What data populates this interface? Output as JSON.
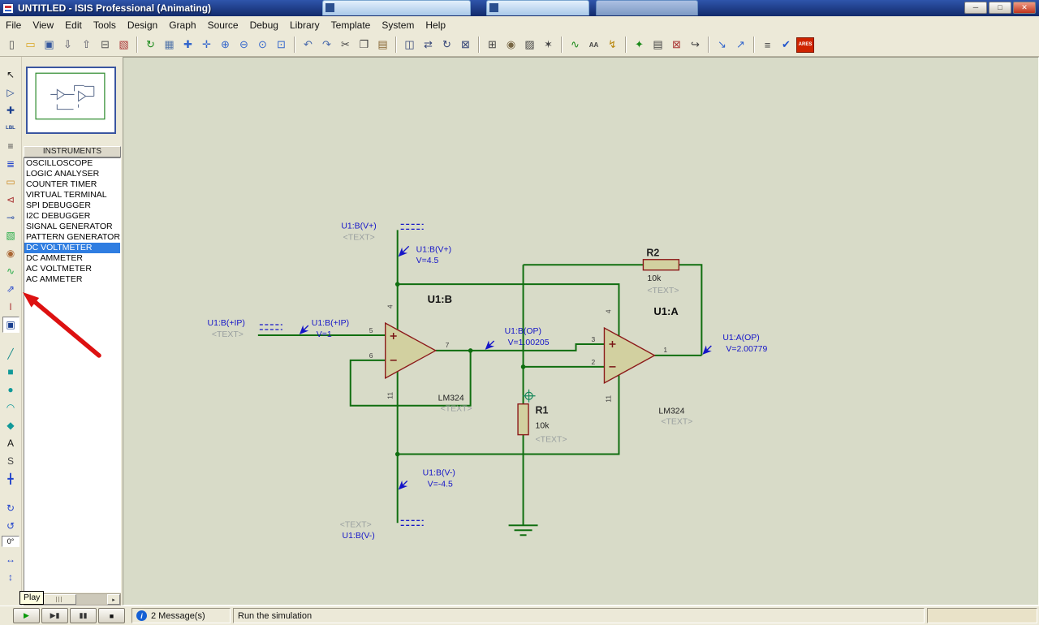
{
  "titlebar": {
    "title": "UNTITLED - ISIS Professional (Animating)",
    "window_buttons": [
      {
        "name": "minimize-button",
        "glyph": "─"
      },
      {
        "name": "maximize-button",
        "glyph": "□"
      },
      {
        "name": "close-button",
        "glyph": "✕"
      }
    ]
  },
  "menu": {
    "items": [
      "File",
      "View",
      "Edit",
      "Tools",
      "Design",
      "Graph",
      "Source",
      "Debug",
      "Library",
      "Template",
      "System",
      "Help"
    ]
  },
  "toolbar": {
    "groups": [
      [
        {
          "name": "new-design-icon",
          "glyph": "▯",
          "color": "#555"
        },
        {
          "name": "open-design-icon",
          "glyph": "▭",
          "color": "#d9a520"
        },
        {
          "name": "save-design-icon",
          "glyph": "▣",
          "color": "#35589e"
        },
        {
          "name": "import-section-icon",
          "glyph": "⇩",
          "color": "#556"
        },
        {
          "name": "export-section-icon",
          "glyph": "⇧",
          "color": "#556"
        },
        {
          "name": "print-design-icon",
          "glyph": "⊟",
          "color": "#555"
        },
        {
          "name": "mark-output-area-icon",
          "glyph": "▧",
          "color": "#a33"
        }
      ],
      [
        {
          "name": "redraw-display-icon",
          "glyph": "↻",
          "color": "#1a8a1a"
        },
        {
          "name": "toggle-grid-icon",
          "glyph": "▦",
          "color": "#5577aa"
        },
        {
          "name": "toggle-origin-icon",
          "glyph": "✚",
          "color": "#3366cc"
        },
        {
          "name": "center-at-cursor-icon",
          "glyph": "✛",
          "color": "#3366cc"
        },
        {
          "name": "zoom-in-icon",
          "glyph": "⊕",
          "color": "#3366cc"
        },
        {
          "name": "zoom-out-icon",
          "glyph": "⊖",
          "color": "#3366cc"
        },
        {
          "name": "zoom-all-icon",
          "glyph": "⊙",
          "color": "#3366cc"
        },
        {
          "name": "zoom-area-icon",
          "glyph": "⊡",
          "color": "#3366cc"
        }
      ],
      [
        {
          "name": "undo-icon",
          "glyph": "↶",
          "color": "#4466aa"
        },
        {
          "name": "redo-icon",
          "glyph": "↷",
          "color": "#4466aa"
        },
        {
          "name": "cut-icon",
          "glyph": "✂",
          "color": "#444"
        },
        {
          "name": "copy-icon",
          "glyph": "❐",
          "color": "#444"
        },
        {
          "name": "paste-icon",
          "glyph": "▤",
          "color": "#886633"
        }
      ],
      [
        {
          "name": "block-copy-icon",
          "glyph": "◫",
          "color": "#334477"
        },
        {
          "name": "block-move-icon",
          "glyph": "⇄",
          "color": "#334477"
        },
        {
          "name": "block-rotate-icon",
          "glyph": "↻",
          "color": "#334477"
        },
        {
          "name": "block-delete-icon",
          "glyph": "⊠",
          "color": "#334477"
        }
      ],
      [
        {
          "name": "pick-parts-icon",
          "glyph": "⊞",
          "color": "#444"
        },
        {
          "name": "make-device-icon",
          "glyph": "◉",
          "color": "#776644"
        },
        {
          "name": "packaging-tool-icon",
          "glyph": "▨",
          "color": "#444"
        },
        {
          "name": "decompose-icon",
          "glyph": "✶",
          "color": "#444"
        }
      ],
      [
        {
          "name": "wire-autorouter-icon",
          "glyph": "∿",
          "color": "#1a8a1a"
        },
        {
          "name": "search-tag-icon",
          "glyph": "AA",
          "color": "#444",
          "small": true
        },
        {
          "name": "property-assignment-icon",
          "glyph": "↯",
          "color": "#b8860b"
        }
      ],
      [
        {
          "name": "design-explorer-icon",
          "glyph": "✦",
          "color": "#1a8a1a"
        },
        {
          "name": "new-sheet-icon",
          "glyph": "▤",
          "color": "#444"
        },
        {
          "name": "remove-sheet-icon",
          "glyph": "⊠",
          "color": "#a33"
        },
        {
          "name": "goto-sheet-icon",
          "glyph": "↪",
          "color": "#444"
        }
      ],
      [
        {
          "name": "zoom-to-child-icon",
          "glyph": "↘",
          "color": "#3366cc"
        },
        {
          "name": "return-to-parent-icon",
          "glyph": "↗",
          "color": "#3366cc"
        }
      ],
      [
        {
          "name": "bill-of-materials-icon",
          "glyph": "≡",
          "color": "#444"
        },
        {
          "name": "electrical-rules-check-icon",
          "glyph": "✔",
          "color": "#2255cc"
        },
        {
          "name": "netlist-to-ares-icon",
          "glyph": "ARES",
          "color": "#fff",
          "special": true
        }
      ]
    ]
  },
  "mode_toolbar": {
    "groups": [
      [
        {
          "name": "selection-pointer-icon",
          "glyph": "↖",
          "color": "#111"
        },
        {
          "name": "component-mode-icon",
          "glyph": "▷",
          "color": "#1a3f8f"
        },
        {
          "name": "junction-dot-icon",
          "glyph": "✚",
          "color": "#1a3f8f"
        },
        {
          "name": "wire-label-icon",
          "glyph": "LBL",
          "color": "#1a3f8f",
          "small": true
        },
        {
          "name": "text-script-icon",
          "glyph": "≡",
          "color": "#444"
        },
        {
          "name": "buses-icon",
          "glyph": "≣",
          "color": "#2244cc"
        },
        {
          "name": "subcircuit-icon",
          "glyph": "▭",
          "color": "#cc8822"
        },
        {
          "name": "terminal-icon",
          "glyph": "⊲",
          "color": "#aa3333"
        },
        {
          "name": "device-pin-icon",
          "glyph": "⊸",
          "color": "#3355aa"
        },
        {
          "name": "graph-icon",
          "glyph": "▧",
          "color": "#22aa44"
        },
        {
          "name": "tape-recorder-icon",
          "glyph": "◉",
          "color": "#aa6633"
        },
        {
          "name": "generator-icon",
          "glyph": "∿",
          "color": "#22aa44"
        },
        {
          "name": "voltage-probe-icon",
          "glyph": "⇗",
          "color": "#2244cc"
        },
        {
          "name": "current-probe-icon",
          "glyph": "I",
          "color": "#aa3333"
        },
        {
          "name": "virtual-instruments-icon",
          "glyph": "▣",
          "color": "#1a3f8f",
          "active": true
        }
      ],
      [
        {
          "name": "line-2d-icon",
          "glyph": "╱",
          "color": "#118888"
        },
        {
          "name": "box-2d-icon",
          "glyph": "■",
          "color": "#119999"
        },
        {
          "name": "circle-2d-icon",
          "glyph": "●",
          "color": "#119999"
        },
        {
          "name": "arc-2d-icon",
          "glyph": "◠",
          "color": "#119999"
        },
        {
          "name": "closed-path-2d-icon",
          "glyph": "◆",
          "color": "#119999"
        },
        {
          "name": "text-2d-icon",
          "glyph": "A",
          "color": "#111"
        },
        {
          "name": "symbol-2d-icon",
          "glyph": "S",
          "color": "#444"
        },
        {
          "name": "marker-2d-icon",
          "glyph": "╋",
          "color": "#2244cc"
        }
      ],
      [
        {
          "name": "rotate-clockwise-icon",
          "glyph": "↻",
          "color": "#2244cc"
        },
        {
          "name": "rotate-anticlockwise-icon",
          "glyph": "↺",
          "color": "#2244cc"
        },
        {
          "name": "rotation-angle-field",
          "glyph": "0°",
          "field": true
        },
        {
          "name": "mirror-horizontal-icon",
          "glyph": "↔",
          "color": "#2244cc"
        },
        {
          "name": "mirror-vertical-icon",
          "glyph": "↕",
          "color": "#2244cc"
        }
      ]
    ]
  },
  "instruments": {
    "header": "INSTRUMENTS",
    "selected_index": 8,
    "items": [
      "OSCILLOSCOPE",
      "LOGIC ANALYSER",
      "COUNTER TIMER",
      "VIRTUAL TERMINAL",
      "SPI DEBUGGER",
      "I2C DEBUGGER",
      "SIGNAL GENERATOR",
      "PATTERN GENERATOR",
      "DC VOLTMETER",
      "DC AMMETER",
      "AC VOLTMETER",
      "AC AMMETER"
    ]
  },
  "circuit": {
    "u1b": {
      "ref": "U1:B",
      "part": "LM324",
      "placeholder": "<TEXT>",
      "pin_plus": "5",
      "pin_minus": "6",
      "pin_out": "7",
      "pin_vcc": "4",
      "pin_vee": "11"
    },
    "u1a": {
      "ref": "U1:A",
      "part": "LM324",
      "placeholder": "<TEXT>",
      "pin_plus": "3",
      "pin_minus": "2",
      "pin_out": "1",
      "pin_vcc": "4",
      "pin_vee": "11"
    },
    "r1": {
      "ref": "R1",
      "value": "10k",
      "placeholder": "<TEXT>"
    },
    "r2": {
      "ref": "R2",
      "value": "10k",
      "placeholder": "<TEXT>"
    },
    "terminals": [
      {
        "label": "U1:B(V+)",
        "placeholder": "<TEXT>"
      },
      {
        "label": "U1:B(+IP)",
        "placeholder": "<TEXT>"
      },
      {
        "label": "U1:B(V-)",
        "placeholder": "<TEXT>"
      }
    ],
    "probes": [
      {
        "label": "U1:B(V+)",
        "value": "V=4.5"
      },
      {
        "label": "U1:B(+IP)",
        "value": "V=1"
      },
      {
        "label": "U1:B(OP)",
        "value": "V=1.00205"
      },
      {
        "label": "U1:A(OP)",
        "value": "V=2.00779"
      },
      {
        "label": "U1:B(V-)",
        "value": "V=-4.5"
      }
    ]
  },
  "playbar": {
    "tooltip": "Play",
    "buttons": [
      {
        "name": "play-button",
        "glyph": "▶",
        "color": "#0a9a0a"
      },
      {
        "name": "step-button",
        "glyph": "▶▮",
        "color": "#333333"
      },
      {
        "name": "pause-button",
        "glyph": "▮▮",
        "color": "#333333"
      },
      {
        "name": "stop-button",
        "glyph": "■",
        "color": "#111111"
      }
    ]
  },
  "statusbar": {
    "message_count": "2 Message(s)",
    "hint": "Run the simulation"
  },
  "colors": {
    "wire": "#106e10",
    "component_fill": "#d2d0a0",
    "component_outline": "#8c1a1a",
    "probe_text": "#1515c8",
    "selection": "#2f7de1",
    "canvas": "#d8dbc8",
    "annotation_arrow": "#dd1111"
  }
}
